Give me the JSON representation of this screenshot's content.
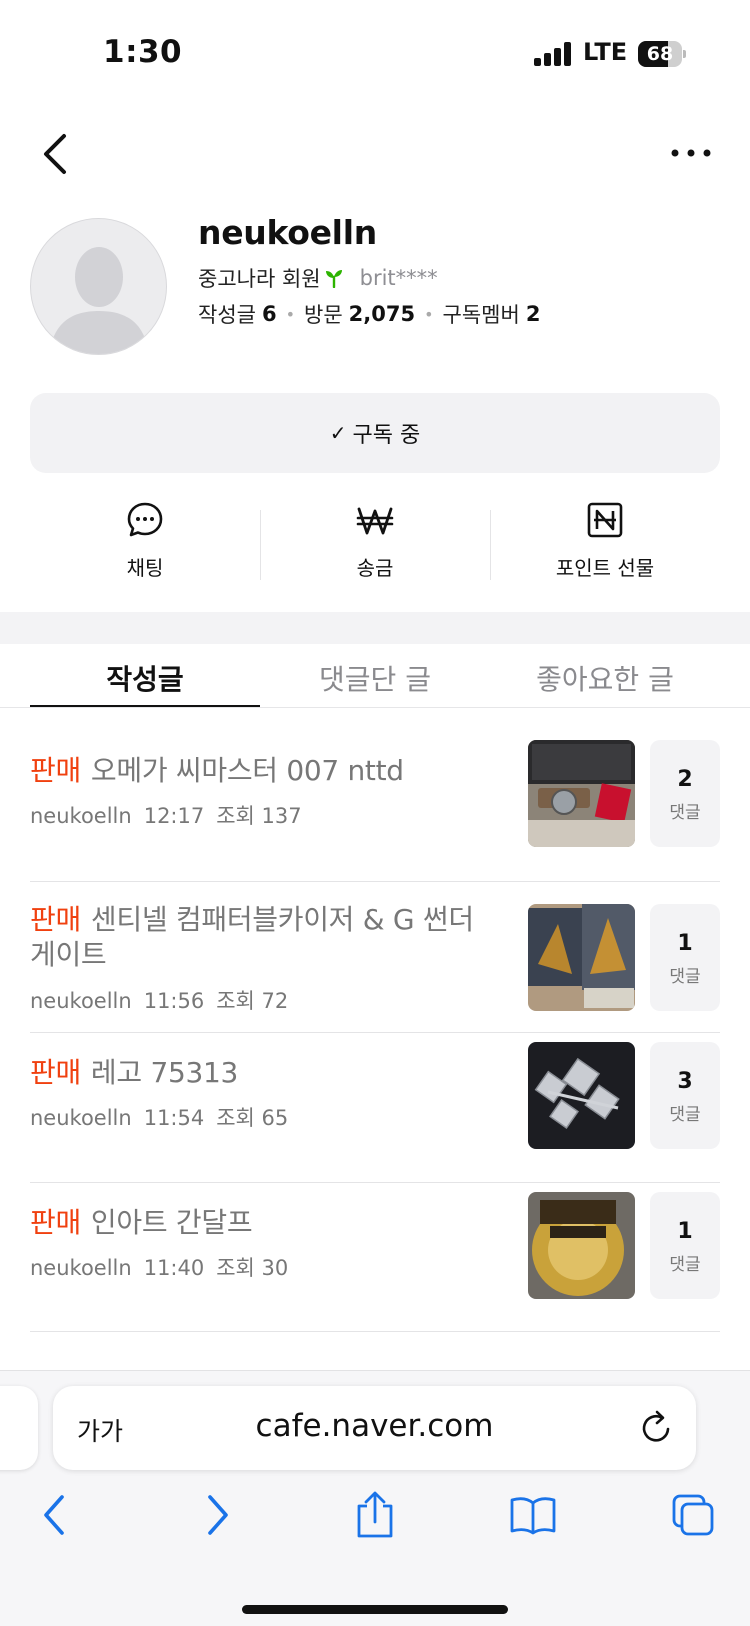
{
  "status": {
    "time": "1:30",
    "network": "LTE",
    "battery": "68",
    "battery_level": 0.68
  },
  "profile": {
    "name": "neukoelln",
    "membership": "중고나라 회원",
    "user_id": "brit****",
    "stats": [
      {
        "label": "작성글",
        "value": "6"
      },
      {
        "label": "방문",
        "value": "2,075"
      },
      {
        "label": "구독멤버",
        "value": "2"
      }
    ]
  },
  "subscribe_label": "구독 중",
  "actions": [
    {
      "label": "채팅",
      "icon": "chat-bubble-icon"
    },
    {
      "label": "송금",
      "icon": "won-icon"
    },
    {
      "label": "포인트 선물",
      "icon": "naver-point-icon"
    }
  ],
  "tabs": [
    {
      "label": "작성글",
      "active": true
    },
    {
      "label": "댓글단 글",
      "active": false
    },
    {
      "label": "좋아요한 글",
      "active": false
    }
  ],
  "posts": [
    {
      "tag": "판매",
      "title": "오메가 씨마스터 007 nttd",
      "author": "neukoelln",
      "time": "12:17",
      "views": "조회 137",
      "comments": "2",
      "comments_label": "댓글"
    },
    {
      "tag": "판매",
      "title": "센티넬 컴패터블카이저 & G 썬더 게이트",
      "author": "neukoelln",
      "time": "11:56",
      "views": "조회 72",
      "comments": "1",
      "comments_label": "댓글"
    },
    {
      "tag": "판매",
      "title": "레고 75313",
      "author": "neukoelln",
      "time": "11:54",
      "views": "조회 65",
      "comments": "3",
      "comments_label": "댓글"
    },
    {
      "tag": "판매",
      "title": "인아트 간달프",
      "author": "neukoelln",
      "time": "11:40",
      "views": "조회 30",
      "comments": "1",
      "comments_label": "댓글"
    }
  ],
  "browser": {
    "text_size_label": "가가",
    "url": "cafe.naver.com"
  },
  "colors": {
    "sale_tag": "#f0400f",
    "link_blue": "#1a73e8"
  }
}
